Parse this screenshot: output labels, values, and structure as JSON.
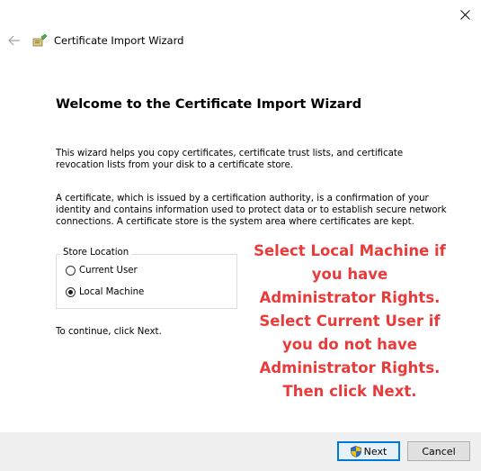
{
  "window": {
    "title": "Certificate Import Wizard",
    "close_icon": "close-icon",
    "back_icon": "back-arrow-icon",
    "app_icon": "certificate-wizard-icon"
  },
  "page": {
    "heading": "Welcome to the Certificate Import Wizard",
    "para1": "This wizard helps you copy certificates, certificate trust lists, and certificate revocation lists from your disk to a certificate store.",
    "para2": "A certificate, which is issued by a certification authority, is a confirmation of your identity and contains information used to protect data or to establish secure network connections. A certificate store is the system area where certificates are kept.",
    "store_location": {
      "legend": "Store Location",
      "options": [
        {
          "label": "Current User",
          "selected": false
        },
        {
          "label": "Local Machine",
          "selected": true
        }
      ]
    },
    "continue_text": "To continue, click Next."
  },
  "annotation": {
    "text": "Select Local Machine if you have Administrator Rights. Select Current User if you do not have Administrator Rights. Then click Next.",
    "color": "#ea3b3b"
  },
  "footer": {
    "next_label": "Next",
    "next_icon": "uac-shield-icon",
    "cancel_label": "Cancel",
    "accent": "#0078d7"
  }
}
